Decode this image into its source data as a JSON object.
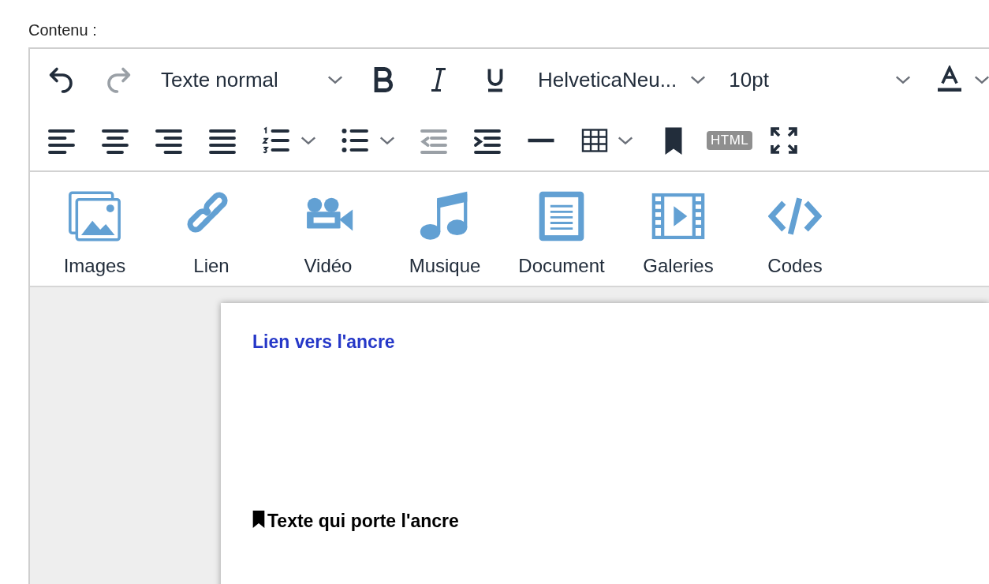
{
  "field_label": "Contenu :",
  "toolbar_rows": [
    [
      {
        "kind": "undo",
        "disabled": false
      },
      {
        "kind": "redo",
        "disabled": true
      },
      {
        "kind": "format-select",
        "value": "Texte normal",
        "disabled": false
      },
      {
        "kind": "bold",
        "disabled": false
      },
      {
        "kind": "italic",
        "disabled": false
      },
      {
        "kind": "underline",
        "disabled": false
      },
      {
        "kind": "font-select",
        "value": "HelveticaNeu...",
        "disabled": false
      },
      {
        "kind": "size-select",
        "value": "10pt",
        "disabled": false
      },
      {
        "kind": "text-color",
        "disabled": false
      }
    ],
    [
      {
        "kind": "align-left",
        "disabled": false
      },
      {
        "kind": "align-center",
        "disabled": false
      },
      {
        "kind": "align-right",
        "disabled": false
      },
      {
        "kind": "justify",
        "disabled": false
      },
      {
        "kind": "numbered-list",
        "disabled": false
      },
      {
        "kind": "bullet-list",
        "disabled": false
      },
      {
        "kind": "outdent",
        "disabled": true
      },
      {
        "kind": "indent",
        "disabled": false
      },
      {
        "kind": "horizontal-rule",
        "disabled": false
      },
      {
        "kind": "table",
        "disabled": false
      },
      {
        "kind": "anchor",
        "disabled": false
      },
      {
        "kind": "html",
        "label": "HTML",
        "disabled": false
      },
      {
        "kind": "fullscreen",
        "disabled": false
      }
    ]
  ],
  "media_buttons": [
    {
      "kind": "images",
      "label": "Images"
    },
    {
      "kind": "link",
      "label": "Lien"
    },
    {
      "kind": "video",
      "label": "Vidéo"
    },
    {
      "kind": "music",
      "label": "Musique"
    },
    {
      "kind": "document",
      "label": "Document"
    },
    {
      "kind": "galleries",
      "label": "Galeries"
    },
    {
      "kind": "code",
      "label": "Codes"
    }
  ],
  "document": {
    "link_text": "Lien vers l'ancre",
    "anchor_text": "Texte qui porte l'ancre"
  }
}
